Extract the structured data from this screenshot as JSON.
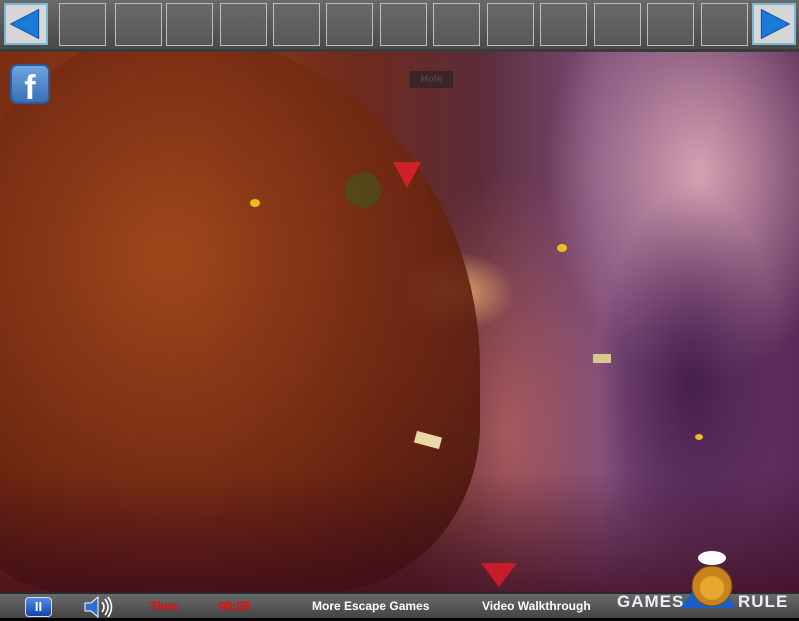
{
  "inventory": {
    "slot_count": 13
  },
  "scene": {
    "sign_text": "Hole"
  },
  "bottom": {
    "time_label": "Time",
    "time_value": "00:09",
    "more_games": "More Escape Games",
    "walkthrough": "Video Walkthrough",
    "logo_left": "GAMES",
    "logo_right": "RULE"
  },
  "social": {
    "facebook": "f"
  },
  "colors": {
    "time": "#ff0000",
    "accent": "#1a7ad8"
  }
}
